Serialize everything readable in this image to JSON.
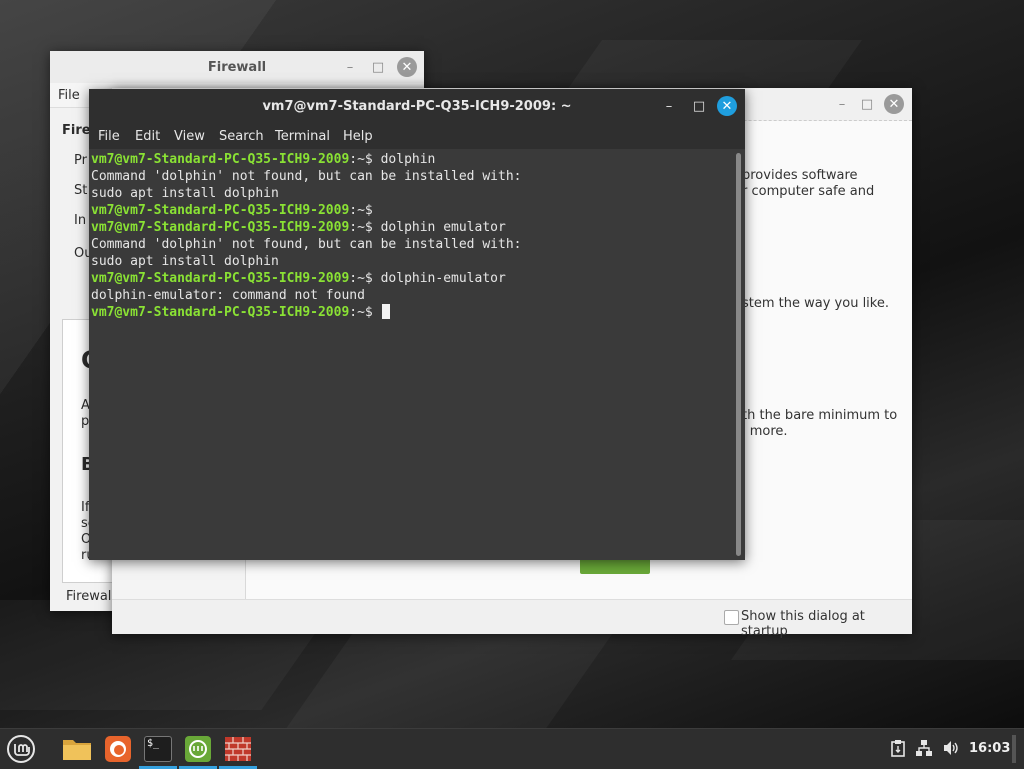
{
  "firewall_window": {
    "title": "Firewall",
    "menu_file": "File",
    "partial_title": "Firew",
    "rows": [
      "Pr",
      "St",
      "In",
      "Ou"
    ],
    "panel_heading": "C",
    "panel_lines1": [
      "A",
      "p"
    ],
    "panel_heading2": "B",
    "panel_lines2": [
      "If",
      "se",
      "O",
      "ru"
    ],
    "footer": "Firewall",
    "minimize": "–",
    "maximize": "□",
    "close": "✕"
  },
  "welcome_window": {
    "text_lines": [
      "provides software",
      "r computer safe and",
      "stem the way you like.",
      "th the bare minimum to",
      "l more."
    ],
    "startup_checkbox_label": "Show this dialog at startup",
    "minimize": "–",
    "maximize": "□",
    "close": "✕"
  },
  "terminal": {
    "title": "vm7@vm7-Standard-PC-Q35-ICH9-2009: ~",
    "menu": [
      "File",
      "Edit",
      "View",
      "Search",
      "Terminal",
      "Help"
    ],
    "minimize": "–",
    "maximize": "□",
    "close": "✕",
    "prompt": "vm7@vm7-Standard-PC-Q35-ICH9-2009",
    "prompt_suffix": ":~$ ",
    "lines": [
      {
        "prompt": true,
        "text": "dolphin"
      },
      {
        "prompt": false,
        "text": "Command 'dolphin' not found, but can be installed with:"
      },
      {
        "prompt": false,
        "text": "sudo apt install dolphin"
      },
      {
        "prompt": true,
        "text": ""
      },
      {
        "prompt": true,
        "text": "dolphin emulator"
      },
      {
        "prompt": false,
        "text": "Command 'dolphin' not found, but can be installed with:"
      },
      {
        "prompt": false,
        "text": "sudo apt install dolphin"
      },
      {
        "prompt": true,
        "text": "dolphin-emulator"
      },
      {
        "prompt": false,
        "text": "dolphin-emulator: command not found"
      },
      {
        "prompt": true,
        "text": "",
        "cursor": true
      }
    ]
  },
  "taskbar": {
    "clock": "16:03",
    "terminal_icon_text": "$_",
    "colors": {
      "accent": "#35a1df",
      "mint_green": "#69a838",
      "firefox": "#e66000",
      "folder": "#e8b64c",
      "firewall": "#c0392b"
    }
  }
}
